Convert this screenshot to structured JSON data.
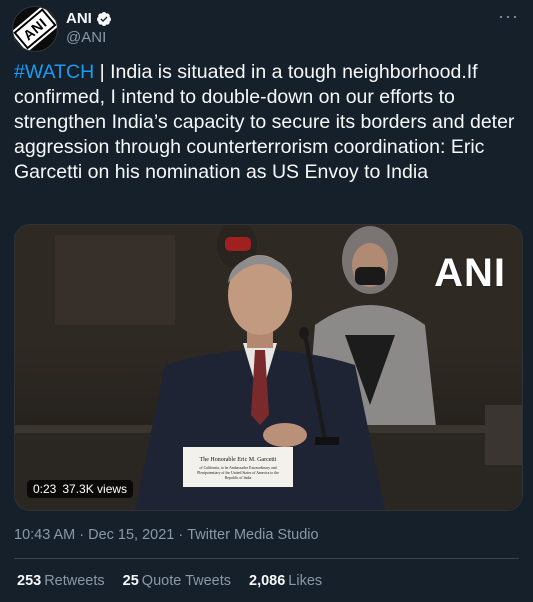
{
  "author": {
    "display_name": "ANI",
    "handle": "@ANI",
    "avatar_text": "ANI",
    "verified": true
  },
  "menu": {
    "more_icon": "···"
  },
  "tweet": {
    "hashtag": "#WATCH",
    "text": " | India is situated in a tough neighborhood.If confirmed, I intend to double-down on our efforts to strengthen India’s capacity to secure its borders and deter aggression through counterterrorism coordination: Eric Garcetti on his nomination as US Envoy to India"
  },
  "media": {
    "watermark": "ANI",
    "duration": "0:23",
    "views": "37.3K views",
    "nameplate_line1": "The Honorable Eric M. Garcetti",
    "nameplate_line2": "of California, to be Ambassador Extraordinary and",
    "nameplate_line3": "Plenipotentiary of the United States of America to the",
    "nameplate_line4": "Republic of India"
  },
  "meta": {
    "time": "10:43 AM",
    "sep1": "·",
    "date": "Dec 15, 2021",
    "sep2": "·",
    "source": "Twitter Media Studio"
  },
  "stats": {
    "retweets_count": "253",
    "retweets_label": "Retweets",
    "quotes_count": "25",
    "quotes_label": "Quote Tweets",
    "likes_count": "2,086",
    "likes_label": "Likes"
  },
  "colors": {
    "background": "#15202b",
    "accent": "#1d9bf0",
    "muted": "#8b98a5",
    "text": "#f7f9f9"
  }
}
